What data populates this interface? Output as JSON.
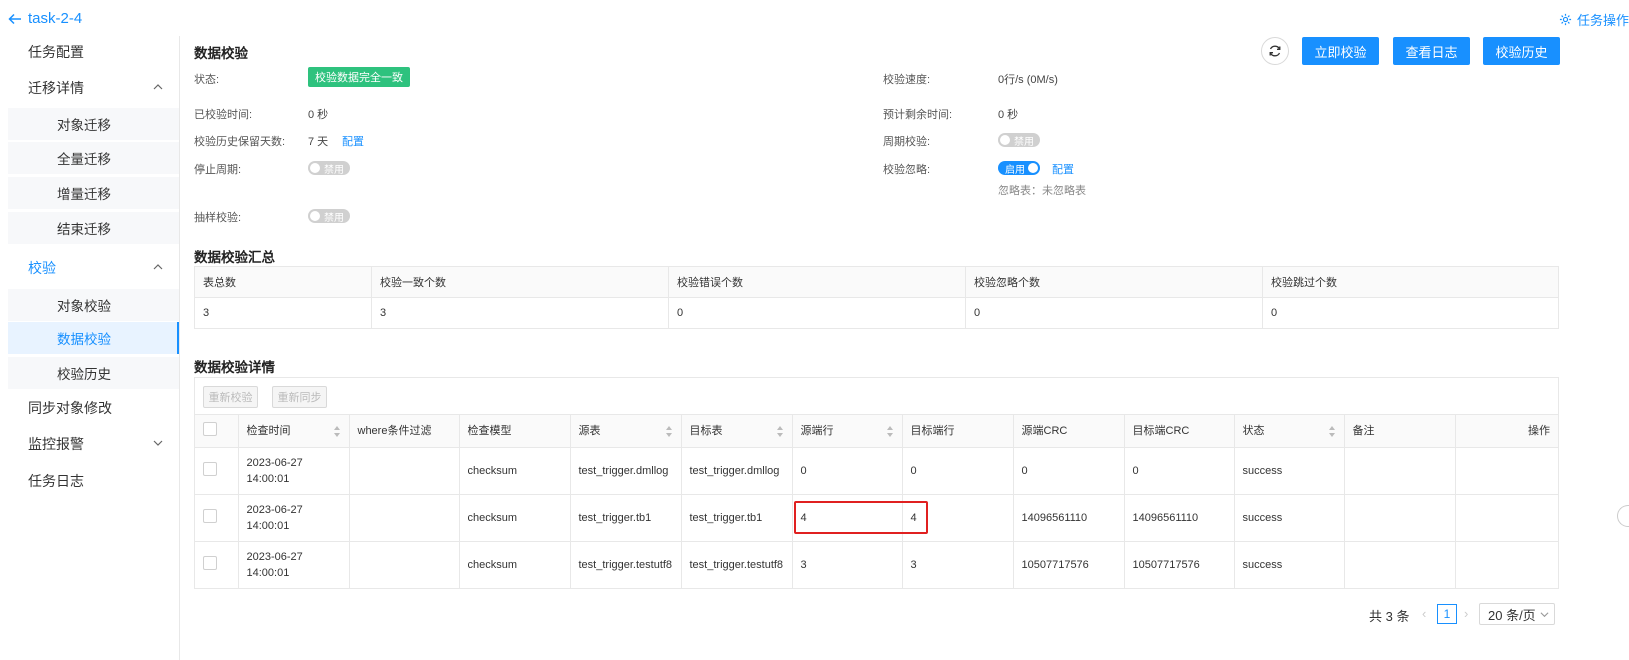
{
  "header": {
    "back_label": "task-2-4",
    "task_ops_label": "任务操作"
  },
  "sidebar": {
    "items": [
      {
        "label": "任务配置"
      },
      {
        "label": "迁移详情"
      },
      {
        "label": "对象迁移"
      },
      {
        "label": "全量迁移"
      },
      {
        "label": "增量迁移"
      },
      {
        "label": "结束迁移"
      },
      {
        "label": "校验"
      },
      {
        "label": "对象校验"
      },
      {
        "label": "数据校验"
      },
      {
        "label": "校验历史"
      },
      {
        "label": "同步对象修改"
      },
      {
        "label": "监控报警"
      },
      {
        "label": "任务日志"
      }
    ]
  },
  "main": {
    "title": "数据校验",
    "buttons": {
      "verify_now": "立即校验",
      "view_log": "查看日志",
      "history": "校验历史"
    },
    "fields": {
      "status_label": "状态:",
      "status_value": "校验数据完全一致",
      "elapsed_label": "已校验时间:",
      "elapsed_value": "0 秒",
      "retain_label": "校验历史保留天数:",
      "retain_value": "7 天",
      "retain_link": "配置",
      "stop_period_label": "停止周期:",
      "stop_period_toggle": "禁用",
      "sampling_label": "抽样校验:",
      "sampling_toggle": "禁用",
      "speed_label": "校验速度:",
      "speed_value": "0行/s (0M/s)",
      "remaining_label": "预计剩余时间:",
      "remaining_value": "0 秒",
      "periodic_label": "周期校验:",
      "periodic_toggle": "禁用",
      "ignore_label": "校验忽略:",
      "ignore_toggle": "启用",
      "ignore_link": "配置",
      "ignore_hint": "忽略表：未忽略表"
    },
    "summary": {
      "title": "数据校验汇总",
      "headers": [
        "表总数",
        "校验一致个数",
        "校验错误个数",
        "校验忽略个数",
        "校验跳过个数"
      ],
      "values": [
        "3",
        "3",
        "0",
        "0",
        "0"
      ]
    },
    "detail": {
      "title": "数据校验详情",
      "reverify_label": "重新校验",
      "resync_label": "重新同步",
      "headers": [
        "检查时间",
        "where条件过滤",
        "检查模型",
        "源表",
        "目标表",
        "源端行",
        "目标端行",
        "源端CRC",
        "目标端CRC",
        "状态",
        "备注",
        "操作"
      ],
      "rows": [
        {
          "time": "2023-06-27 14:00:01",
          "where": "",
          "model": "checksum",
          "src": "test_trigger.dmllog",
          "dst": "test_trigger.dmllog",
          "src_rows": "0",
          "dst_rows": "0",
          "src_crc": "0",
          "dst_crc": "0",
          "status": "success",
          "note": "",
          "op": ""
        },
        {
          "time": "2023-06-27 14:00:01",
          "where": "",
          "model": "checksum",
          "src": "test_trigger.tb1",
          "dst": "test_trigger.tb1",
          "src_rows": "4",
          "dst_rows": "4",
          "src_crc": "14096561110",
          "dst_crc": "14096561110",
          "status": "success",
          "note": "",
          "op": ""
        },
        {
          "time": "2023-06-27 14:00:01",
          "where": "",
          "model": "checksum",
          "src": "test_trigger.testutf8",
          "dst": "test_trigger.testutf8",
          "src_rows": "3",
          "dst_rows": "3",
          "src_crc": "10507717576",
          "dst_crc": "10507717576",
          "status": "success",
          "note": "",
          "op": ""
        }
      ]
    },
    "pagination": {
      "total": "共 3 条",
      "page": "1",
      "page_size": "20 条/页"
    }
  }
}
